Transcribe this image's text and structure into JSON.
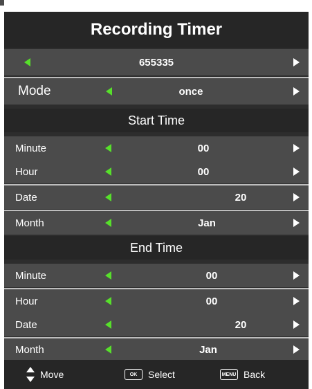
{
  "title": "Recording Timer",
  "channel": {
    "value": "655335"
  },
  "mode": {
    "label": "Mode",
    "value": "once"
  },
  "start_time": {
    "heading": "Start Time",
    "rows": [
      {
        "label": "Minute",
        "value": "00"
      },
      {
        "label": "Hour",
        "value": "00"
      },
      {
        "label": "Date",
        "value": "20"
      },
      {
        "label": "Month",
        "value": "Jan"
      }
    ]
  },
  "end_time": {
    "heading": "End Time",
    "rows": [
      {
        "label": "Minute",
        "value": "00"
      },
      {
        "label": "Hour",
        "value": "00"
      },
      {
        "label": "Date",
        "value": "20"
      },
      {
        "label": "Month",
        "value": "Jan"
      }
    ]
  },
  "footer": {
    "move_label": "Move",
    "ok_key": "OK",
    "select_label": "Select",
    "menu_key": "MENU",
    "back_label": "Back"
  },
  "colors": {
    "left_arrow": "#57e02b",
    "right_arrow": "#ffffff",
    "row_bg": "#4b4b4b",
    "header_bg": "#262626"
  },
  "icons": {
    "left": "left-triangle-icon",
    "right": "right-triangle-icon",
    "move": "up-down-arrows-icon"
  }
}
